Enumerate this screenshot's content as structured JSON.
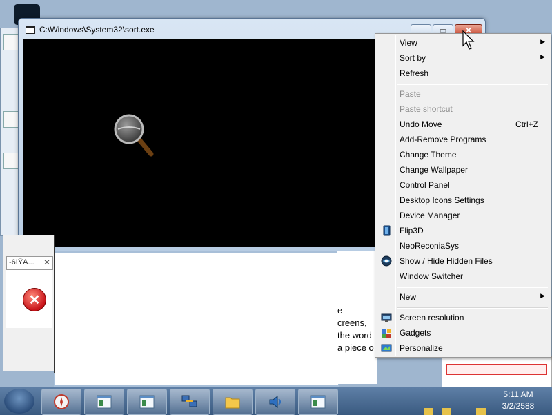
{
  "console_window": {
    "title": "C:\\Windows\\System32\\sort.exe",
    "min_glyph": "▁",
    "max_glyph": "▭",
    "close_glyph": "✕"
  },
  "error_dialog": {
    "title": "-6IỸA...",
    "close_glyph": "✕",
    "icon_glyph": "✕"
  },
  "partial_text": {
    "line1": "e",
    "line2": "creens,",
    "line3": "the word",
    "line4": "a piece o"
  },
  "context_menu": {
    "items": [
      {
        "label": "View",
        "arrow": "▶"
      },
      {
        "label": "Sort by",
        "arrow": "▶"
      },
      {
        "label": "Refresh"
      },
      {
        "label": "Paste",
        "disabled": true
      },
      {
        "label": "Paste shortcut",
        "disabled": true
      },
      {
        "label": "Undo Move",
        "shortcut": "Ctrl+Z"
      },
      {
        "label": "Add-Remove Programs"
      },
      {
        "label": "Change Theme"
      },
      {
        "label": "Change Wallpaper"
      },
      {
        "label": "Control Panel"
      },
      {
        "label": "Desktop Icons Settings"
      },
      {
        "label": "Device Manager"
      },
      {
        "label": "Flip3D"
      },
      {
        "label": "NeoReconiaSys"
      },
      {
        "label": "Show / Hide Hidden Files"
      },
      {
        "label": "Window Switcher"
      },
      {
        "label": "New",
        "arrow": "▶"
      },
      {
        "label": "Screen resolution"
      },
      {
        "label": "Gadgets"
      },
      {
        "label": "Personalize"
      }
    ]
  },
  "taskbar": {
    "clock_time": "5:11 AM",
    "clock_date": "3/2/2588"
  },
  "colors": {
    "menu_bg": "#f0f0f0",
    "console_bg": "#000000",
    "taskbar": "#3a5a80",
    "disabled_text": "#8d8d8d"
  }
}
